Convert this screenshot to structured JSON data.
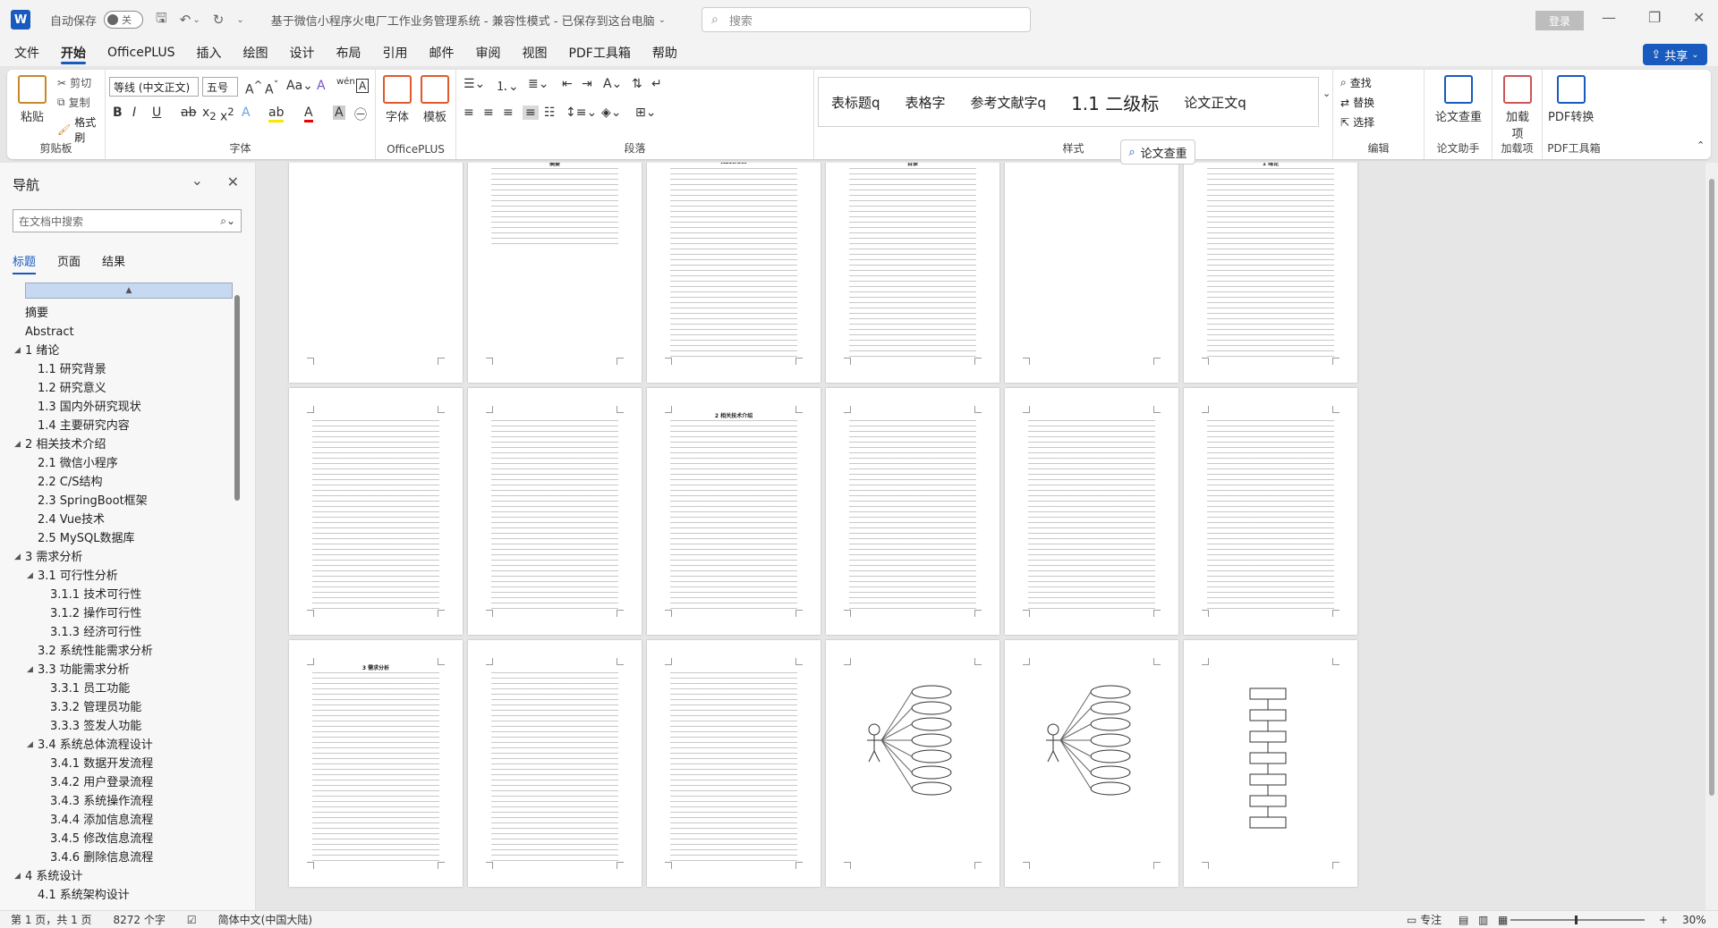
{
  "titlebar": {
    "autosave_label": "自动保存",
    "autosave_state": "关",
    "doc_title": "基于微信小程序火电厂工作业务管理系统 - 兼容性模式 - 已保存到这台电脑",
    "search_placeholder": "搜索",
    "login_label": "登录"
  },
  "menu": {
    "items": [
      "文件",
      "开始",
      "OfficePLUS",
      "插入",
      "绘图",
      "设计",
      "布局",
      "引用",
      "邮件",
      "审阅",
      "视图",
      "PDF工具箱",
      "帮助"
    ],
    "active": "开始",
    "share_label": "共享"
  },
  "ribbon": {
    "clipboard": {
      "paste": "粘贴",
      "cut": "剪切",
      "copy": "复制",
      "format_painter": "格式刷",
      "label": "剪贴板"
    },
    "font": {
      "name": "等线 (中文正文)",
      "size": "五号",
      "label": "字体"
    },
    "officeplus": {
      "font_btn": "字体",
      "template_btn": "模板",
      "label": "OfficePLUS"
    },
    "paragraph": {
      "label": "段落"
    },
    "styles": {
      "items": [
        "表标题q",
        "表格字",
        "参考文献字q",
        "1.1  二级标",
        "论文正文q"
      ],
      "label": "样式"
    },
    "editing": {
      "find": "查找",
      "replace": "替换",
      "select": "选择",
      "label": "编辑"
    },
    "assistant": {
      "btn": "论文查重",
      "label": "论文助手"
    },
    "addins": {
      "btn": "加载项",
      "label": "加载项"
    },
    "pdf": {
      "btn": "PDF转换",
      "label": "PDF工具箱"
    }
  },
  "nav": {
    "title": "导航",
    "search_placeholder": "在文档中搜索",
    "tabs": [
      "标题",
      "页面",
      "结果"
    ],
    "active_tab": "标题",
    "items": [
      {
        "label": "摘要",
        "level": 0,
        "toggle": ""
      },
      {
        "label": "Abstract",
        "level": 0,
        "toggle": ""
      },
      {
        "label": "1 绪论",
        "level": 0,
        "toggle": "◢"
      },
      {
        "label": "1.1 研究背景",
        "level": 1,
        "toggle": ""
      },
      {
        "label": "1.2 研究意义",
        "level": 1,
        "toggle": ""
      },
      {
        "label": "1.3 国内外研究现状",
        "level": 1,
        "toggle": ""
      },
      {
        "label": "1.4 主要研究内容",
        "level": 1,
        "toggle": ""
      },
      {
        "label": "2 相关技术介绍",
        "level": 0,
        "toggle": "◢"
      },
      {
        "label": "2.1 微信小程序",
        "level": 1,
        "toggle": ""
      },
      {
        "label": "2.2 C/S结构",
        "level": 1,
        "toggle": ""
      },
      {
        "label": "2.3  SpringBoot框架",
        "level": 1,
        "toggle": ""
      },
      {
        "label": "2.4  Vue技术",
        "level": 1,
        "toggle": ""
      },
      {
        "label": "2.5   MySQL数据库",
        "level": 1,
        "toggle": ""
      },
      {
        "label": "3 需求分析",
        "level": 0,
        "toggle": "◢"
      },
      {
        "label": "3.1 可行性分析",
        "level": 1,
        "toggle": "◢"
      },
      {
        "label": "3.1.1 技术可行性",
        "level": 2,
        "toggle": ""
      },
      {
        "label": "3.1.2 操作可行性",
        "level": 2,
        "toggle": ""
      },
      {
        "label": "3.1.3 经济可行性",
        "level": 2,
        "toggle": ""
      },
      {
        "label": "3.2 系统性能需求分析",
        "level": 1,
        "toggle": ""
      },
      {
        "label": "3.3 功能需求分析",
        "level": 1,
        "toggle": "◢"
      },
      {
        "label": "3.3.1 员工功能",
        "level": 2,
        "toggle": ""
      },
      {
        "label": "3.3.2 管理员功能",
        "level": 2,
        "toggle": ""
      },
      {
        "label": "3.3.3 签发人功能",
        "level": 2,
        "toggle": ""
      },
      {
        "label": "3.4 系统总体流程设计",
        "level": 1,
        "toggle": "◢"
      },
      {
        "label": "3.4.1 数据开发流程",
        "level": 2,
        "toggle": ""
      },
      {
        "label": "3.4.2 用户登录流程",
        "level": 2,
        "toggle": ""
      },
      {
        "label": "3.4.3 系统操作流程",
        "level": 2,
        "toggle": ""
      },
      {
        "label": "3.4.4 添加信息流程",
        "level": 2,
        "toggle": ""
      },
      {
        "label": "3.4.5 修改信息流程",
        "level": 2,
        "toggle": ""
      },
      {
        "label": "3.4.6 删除信息流程",
        "level": 2,
        "toggle": ""
      },
      {
        "label": "4 系统设计",
        "level": 0,
        "toggle": "◢"
      },
      {
        "label": "4.1 系统架构设计",
        "level": 1,
        "toggle": ""
      }
    ]
  },
  "pages": {
    "row1_titles": [
      "",
      "摘要",
      "Abstract",
      "目录",
      "",
      "1  绪论"
    ],
    "row2_titles": [
      "",
      "",
      "2  相关技术介绍",
      "",
      "",
      ""
    ],
    "row3_titles": [
      "3  需求分析",
      "",
      "",
      "",
      "",
      ""
    ],
    "float_btn": "论文查重"
  },
  "statusbar": {
    "page_info": "第 1 页，共 1 页",
    "word_count": "8272 个字",
    "language": "简体中文(中国大陆)",
    "focus": "专注",
    "zoom": "30%"
  },
  "colors": {
    "accent": "#185abd",
    "ribbon_bg": "#ffffff",
    "chrome_bg": "#f3f3f3"
  }
}
